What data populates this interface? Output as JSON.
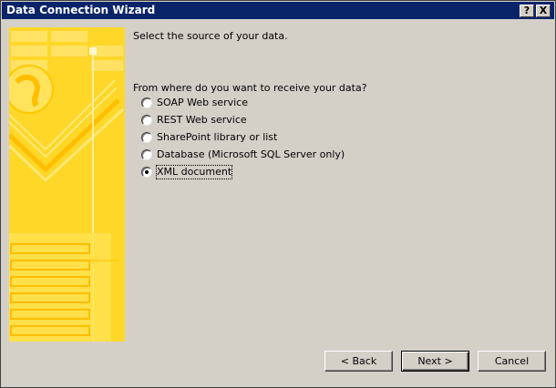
{
  "window": {
    "title": "Data Connection Wizard",
    "help_button": "?",
    "close_button": "X"
  },
  "main": {
    "prompt": "Select the source of your data.",
    "question": "From where do you want to receive your data?",
    "options": [
      {
        "label": "SOAP Web service",
        "selected": false
      },
      {
        "label": "REST Web service",
        "selected": false
      },
      {
        "label": "SharePoint library or list",
        "selected": false
      },
      {
        "label": "Database (Microsoft SQL Server only)",
        "selected": false
      },
      {
        "label": "XML document",
        "selected": true
      }
    ]
  },
  "buttons": {
    "back": "< Back",
    "next": "Next >",
    "cancel": "Cancel"
  },
  "colors": {
    "titlebar": "#0a246a",
    "dialog": "#d4d0c8",
    "art_yellow": "#ffd21a"
  }
}
